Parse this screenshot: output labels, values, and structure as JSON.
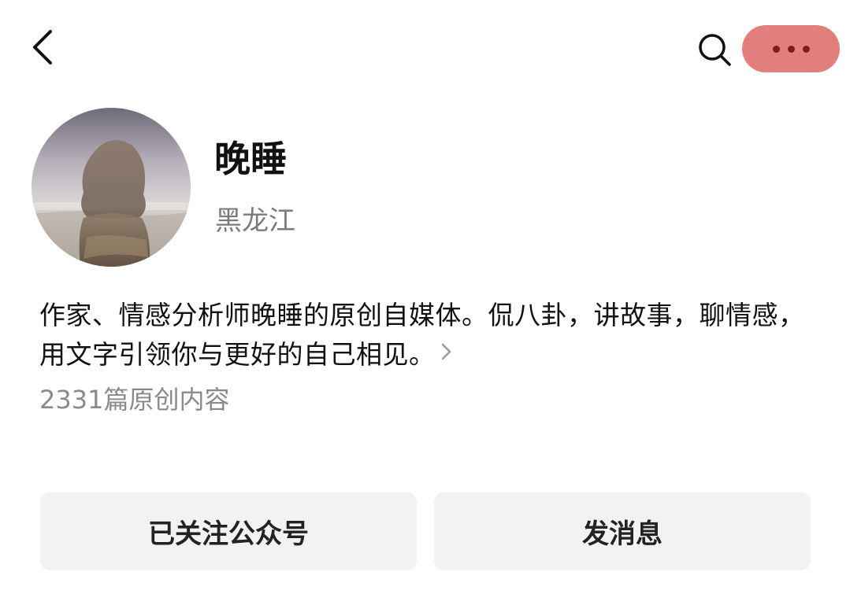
{
  "header": {
    "back_icon": "chevron-left-icon",
    "search_icon": "search-icon",
    "more_icon": "more-dots-icon",
    "more_button_color": "#e27e7c"
  },
  "profile": {
    "avatar_icon": "avatar-photo",
    "name": "晚睡",
    "region": "黑龙江",
    "bio": "作家、情感分析师晚睡的原创自媒体。侃八卦，讲故事，聊情感，用文字引领你与更好的自己相见。",
    "bio_more_icon": "chevron-right-icon",
    "article_count": "2331篇原创内容"
  },
  "actions": {
    "follow_label": "已关注公众号",
    "message_label": "发消息"
  }
}
